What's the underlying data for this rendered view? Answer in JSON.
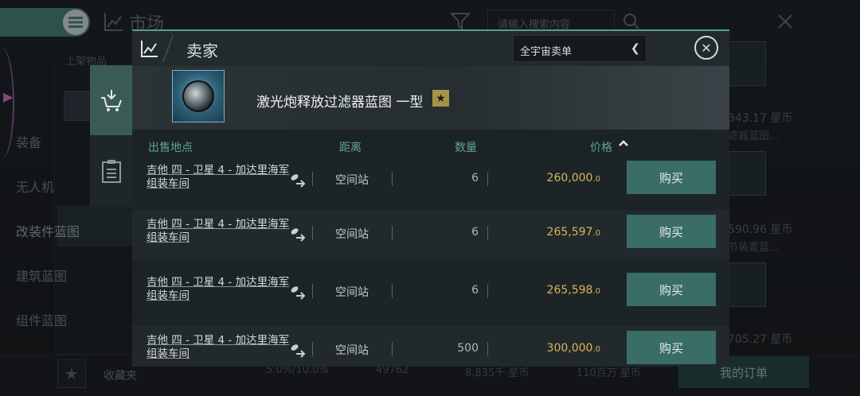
{
  "background": {
    "market_title": "市场",
    "search_placeholder": "请输入搜索内容",
    "category_header": "上架物品",
    "categories": [
      "装备",
      "无人机",
      "改装件蓝图",
      "建筑蓝图",
      "组件蓝图"
    ],
    "selected_category": "改装件蓝图",
    "favorites_label": "收藏夹",
    "stats": [
      "5.0%/10.0%",
      "49762",
      "8,835千 星币",
      "110百万 星币"
    ],
    "my_orders_label": "我的订单",
    "right_items": [
      {
        "price": "343.17 星币",
        "name": "滤器蓝图..."
      },
      {
        "price": "590.96 星币",
        "name": "节装置蓝..."
      },
      {
        "price": "705.27 星币",
        "name": ""
      }
    ]
  },
  "modal": {
    "title": "卖家",
    "region_select": "全宇宙卖单",
    "item_name": "激光炮释放过滤器蓝图 一型",
    "star": "★",
    "columns": {
      "location": "出售地点",
      "distance": "距离",
      "quantity": "数量",
      "price": "价格"
    },
    "sort_indicator": "^",
    "buy_label": "购买",
    "rows": [
      {
        "location": "吉他 四 - 卫星 4 - 加达里海军 组装车间",
        "distance": "空间站",
        "quantity": "6",
        "price_int": "260,000",
        "price_dec": ".0"
      },
      {
        "location": "吉他 四 - 卫星 4 - 加达里海军 组装车间",
        "distance": "空间站",
        "quantity": "6",
        "price_int": "265,597",
        "price_dec": ".0"
      },
      {
        "location": "吉他 四 - 卫星 4 - 加达里海军 组装车间",
        "distance": "空间站",
        "quantity": "6",
        "price_int": "265,598",
        "price_dec": ".0"
      },
      {
        "location": "吉他 四 - 卫星 4 - 加达里海军 组装车间",
        "distance": "空间站",
        "quantity": "500",
        "price_int": "300,000",
        "price_dec": ".0"
      }
    ]
  },
  "colors": {
    "accent": "#3a6d66",
    "header_text": "#5ea596",
    "price": "#d7b55f"
  }
}
